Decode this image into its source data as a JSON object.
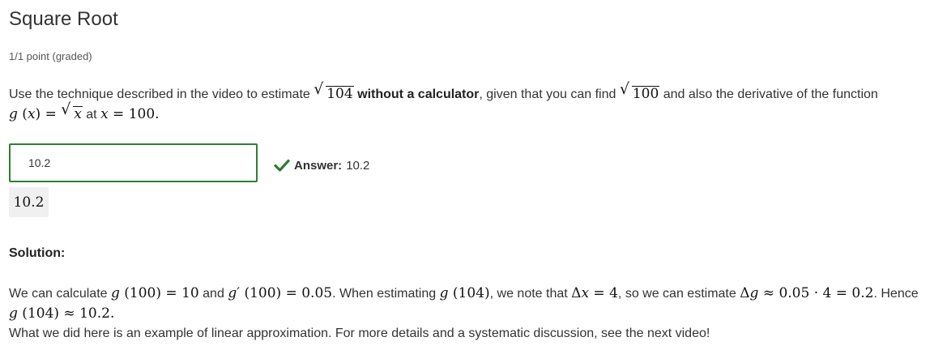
{
  "problem": {
    "title": "Square Root",
    "points": "1/1 point (graded)",
    "text": {
      "intro": "Use the technique described in the video to estimate",
      "radicand_1": "104",
      "bold": "without a calculator",
      "mid": ", given that you can find",
      "radicand_2": "100",
      "tail": "and also the derivative of the function",
      "func_g": "g",
      "func_x": "x",
      "func_sqrt_x": "x",
      "at_word": "at",
      "at_x": "x",
      "at_value": "100"
    }
  },
  "answer": {
    "input_value": "10.2",
    "status_label": "Answer:",
    "status_value": "10.2",
    "preview": "10.2",
    "status_color": "#2e7d32"
  },
  "solution": {
    "heading": "Solution:",
    "line1": {
      "a": "We can calculate",
      "g100_val": "10",
      "and": "and",
      "gp100_val": "0.05",
      "b": ". When estimating",
      "g104_arg": "104",
      "c": ", we note that",
      "dx_val": "4",
      "d": ", so we can estimate",
      "prod_a": "0.05",
      "prod_b": "4",
      "prod_res": "0.2",
      "e": ". Hence"
    },
    "line2": {
      "arg": "104",
      "val": "10.2"
    },
    "line3": "What we did here is an example of linear approximation. For more details and a systematic discussion, see the next video!"
  },
  "icons": {
    "status": "checkmark-icon"
  }
}
